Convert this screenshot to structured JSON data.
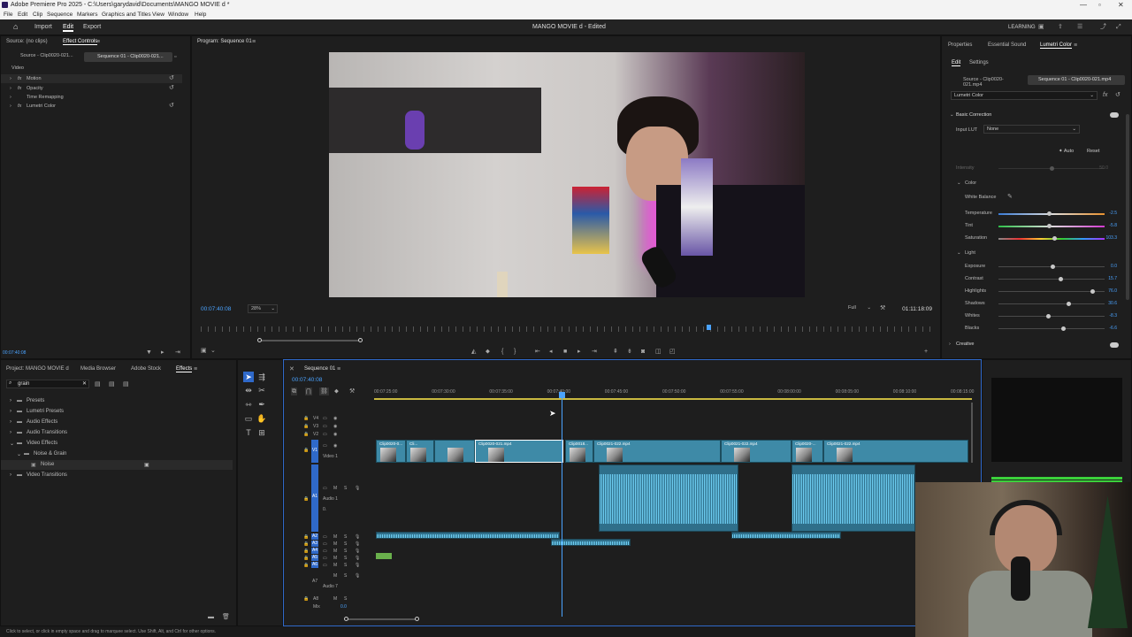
{
  "window": {
    "title": "Adobe Premiere Pro 2025 - C:\\Users\\garydavid\\Documents\\MANGO MOVIE d *"
  },
  "menu": [
    "File",
    "Edit",
    "Clip",
    "Sequence",
    "Markers",
    "Graphics and Titles",
    "View",
    "Window",
    "Help"
  ],
  "header": {
    "workspaces": [
      "Import",
      "Edit",
      "Export"
    ],
    "active_workspace": "Edit",
    "project_title": "MANGO MOVIE d",
    "edited": "- Edited",
    "learning": "LEARNING"
  },
  "effect_controls": {
    "tabs": [
      "Source: (no clips)",
      "Effect Controls"
    ],
    "active_tab": "Effect Controls",
    "source_clip": "Source - Clip0020-021...",
    "sequence_clip": "Sequence 01 - Clip0020-021...",
    "section": "Video",
    "effects": [
      {
        "label": "Motion",
        "fx": "fx"
      },
      {
        "label": "Opacity",
        "fx": "fx"
      },
      {
        "label": "Time Remapping",
        "fx": ""
      },
      {
        "label": "Lumetri Color",
        "fx": "fx"
      }
    ],
    "timecode": "00:07:40:08"
  },
  "program": {
    "tab": "Program: Sequence 01",
    "timecode": "00:07:40:08",
    "zoom": "28%",
    "quality": "Full",
    "duration": "01:11:18:09"
  },
  "lumetri": {
    "tabs": [
      "Properties",
      "Essential Sound",
      "Lumetri Color"
    ],
    "active_tab": "Lumetri Color",
    "subtabs": [
      "Edit",
      "Settings"
    ],
    "source_clip": "Source - Clip0020-021.mp4",
    "sequence_clip": "Sequence 01 - Clip0020-021.mp4",
    "effect": "Lumetri Color",
    "basic": "Basic Correction",
    "input_lut_label": "Input LUT",
    "input_lut": "None",
    "auto": "Auto",
    "reset": "Reset",
    "intensity": "Intensity",
    "intensity_val": "50.0",
    "color_header": "Color",
    "white_balance": "White Balance",
    "color_sliders": [
      {
        "label": "Temperature",
        "value": "-2.5",
        "pos": 0.47
      },
      {
        "label": "Tint",
        "value": "-5.8",
        "pos": 0.47
      },
      {
        "label": "Saturation",
        "value": "103.3",
        "pos": 0.52
      }
    ],
    "light_header": "Light",
    "light_sliders": [
      {
        "label": "Exposure",
        "value": "0.0",
        "pos": 0.5
      },
      {
        "label": "Contrast",
        "value": "15.7",
        "pos": 0.58
      },
      {
        "label": "Highlights",
        "value": "76.0",
        "pos": 0.88
      },
      {
        "label": "Shadows",
        "value": "30.6",
        "pos": 0.65
      },
      {
        "label": "Whites",
        "value": "-8.3",
        "pos": 0.46
      },
      {
        "label": "Blacks",
        "value": "-6.6",
        "pos": 0.6
      }
    ],
    "creative": "Creative"
  },
  "project": {
    "tabs": [
      "Project: MANGO MOVIE d",
      "Media Browser",
      "Adobe Stock",
      "Effects"
    ],
    "active_tab": "Effects",
    "search": "grain",
    "tree": [
      {
        "label": "Presets",
        "level": 0,
        "open": false
      },
      {
        "label": "Lumetri Presets",
        "level": 0,
        "open": false
      },
      {
        "label": "Audio Effects",
        "level": 0,
        "open": false
      },
      {
        "label": "Audio Transitions",
        "level": 0,
        "open": false
      },
      {
        "label": "Video Effects",
        "level": 0,
        "open": true
      },
      {
        "label": "Noise & Grain",
        "level": 1,
        "open": true
      },
      {
        "label": "Noise",
        "level": 2,
        "open": false
      },
      {
        "label": "Video Transitions",
        "level": 0,
        "open": false
      }
    ]
  },
  "timeline": {
    "tab": "Sequence 01",
    "timecode": "00:07:40:08",
    "ruler": [
      "00:07:25:00",
      "00:07:30:00",
      "00:07:35:00",
      "00:07:40:00",
      "00:07:45:00",
      "00:07:50:00",
      "00:07:55:00",
      "00:08:00:00",
      "00:08:05:00",
      "00:08:10:00",
      "00:08:15:00"
    ],
    "video_tracks": [
      "V4",
      "V3",
      "V2",
      "V1"
    ],
    "video1": "Video 1",
    "audio_tracks": [
      "A1",
      "A2",
      "A3",
      "A4",
      "A5",
      "A6",
      "A7",
      "A8"
    ],
    "audio1": "Audio 1",
    "audio7": "Audio 7",
    "audio1_val": "0.",
    "mix": "Mix",
    "mix_val": "0.0",
    "clips": [
      "Clip0020-0...",
      "Cli...",
      "Clip0020-021.mp4",
      "Clip0018...",
      "Clip0021-022.mp4",
      "Clip0021-022.mp4",
      "Clip0020-...",
      "Clip0021-022.mp4"
    ]
  },
  "status": {
    "hint": "Click to select, or click in empty space and drag to marquee select. Use Shift, Alt, and Ctrl for other options."
  }
}
